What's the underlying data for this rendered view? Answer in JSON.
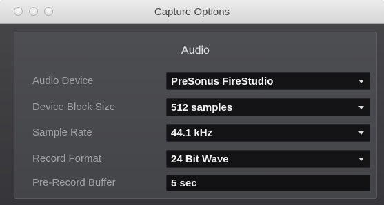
{
  "window": {
    "title": "Capture Options"
  },
  "section": {
    "title": "Audio"
  },
  "fields": {
    "audio_device": {
      "label": "Audio Device",
      "value": "PreSonus FireStudio"
    },
    "block_size": {
      "label": "Device Block Size",
      "value": "512 samples"
    },
    "sample_rate": {
      "label": "Sample Rate",
      "value": "44.1 kHz"
    },
    "record_format": {
      "label": "Record Format",
      "value": "24 Bit Wave"
    },
    "pre_record_buffer": {
      "label": "Pre-Record Buffer",
      "value": "5 sec"
    }
  },
  "icons": {
    "close": "traffic-light-icon",
    "minimize": "traffic-light-icon",
    "zoom": "traffic-light-icon",
    "dropdown_arrow": "triangle-down-icon"
  }
}
